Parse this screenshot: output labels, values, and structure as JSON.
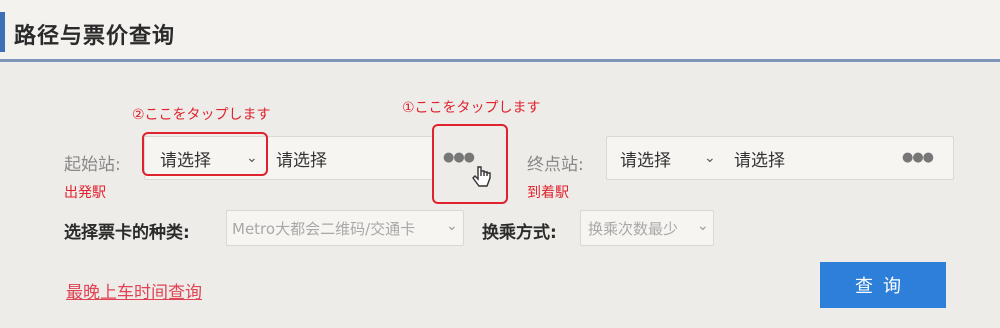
{
  "header": {
    "title": "路径与票价查询"
  },
  "annotations": {
    "tap_origin": "②ここをタップします",
    "tap_swap": "①ここをタップします",
    "origin_note": "出発駅",
    "destination_note": "到着駅"
  },
  "origin": {
    "label": "起始站:",
    "line_select": "请选择",
    "station_select": "请选择"
  },
  "destination": {
    "label": "终点站:",
    "line_select": "请选择",
    "station_select": "请选择"
  },
  "ticket": {
    "label": "选择票卡的种类:",
    "value": "Metro大都会二维码/交通卡"
  },
  "transfer": {
    "label": "换乘方式:",
    "value": "换乘次数最少"
  },
  "links": {
    "last_train": "最晚上车时间查询"
  },
  "buttons": {
    "query": "查询"
  },
  "colors": {
    "accent": "#2e7fd9",
    "annotation": "#e0222e",
    "link": "#e04454"
  }
}
